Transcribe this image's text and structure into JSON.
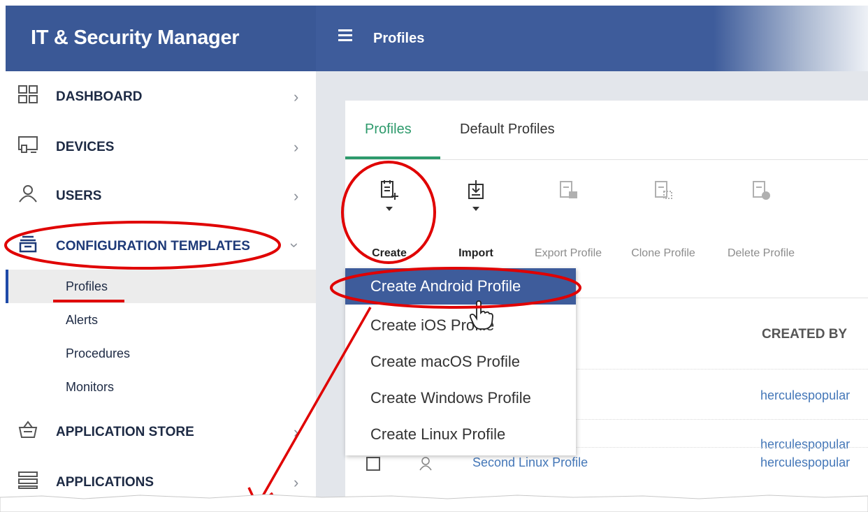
{
  "app": {
    "title": "IT & Security Manager"
  },
  "header": {
    "page_title": "Profiles"
  },
  "sidebar": {
    "items": [
      {
        "label": "DASHBOARD",
        "icon": "dashboard-icon"
      },
      {
        "label": "DEVICES",
        "icon": "devices-icon"
      },
      {
        "label": "USERS",
        "icon": "user-icon"
      },
      {
        "label": "CONFIGURATION TEMPLATES",
        "icon": "templates-icon"
      },
      {
        "label": "APPLICATION STORE",
        "icon": "store-icon"
      },
      {
        "label": "APPLICATIONS",
        "icon": "applications-icon"
      }
    ],
    "sub_items": [
      {
        "label": "Profiles"
      },
      {
        "label": "Alerts"
      },
      {
        "label": "Procedures"
      },
      {
        "label": "Monitors"
      }
    ]
  },
  "tabs": [
    {
      "label": "Profiles"
    },
    {
      "label": "Default Profiles"
    }
  ],
  "toolbar": {
    "create": "Create",
    "import": "Import",
    "export_profile": "Export Profile",
    "clone_profile": "Clone Profile",
    "delete_profile": "Delete Profile",
    "more_cut": "Ex"
  },
  "table": {
    "col_created_by": "CREATED BY",
    "rows": [
      {
        "name": "",
        "created_by": "herculespopular"
      },
      {
        "name": "",
        "created_by": "herculespopular"
      },
      {
        "name": "Second Linux Profile",
        "created_by": "herculespopular"
      }
    ]
  },
  "create_menu": {
    "items": [
      {
        "label": "Create Android Profile"
      },
      {
        "label": "Create iOS Profile"
      },
      {
        "label": "Create macOS Profile"
      },
      {
        "label": "Create Windows Profile"
      },
      {
        "label": "Create Linux Profile"
      }
    ]
  },
  "colors": {
    "header_blue": "#3a5896",
    "accent_green": "#2e9a6c",
    "annotation_red": "#e00000",
    "link_blue": "#4477b8"
  }
}
